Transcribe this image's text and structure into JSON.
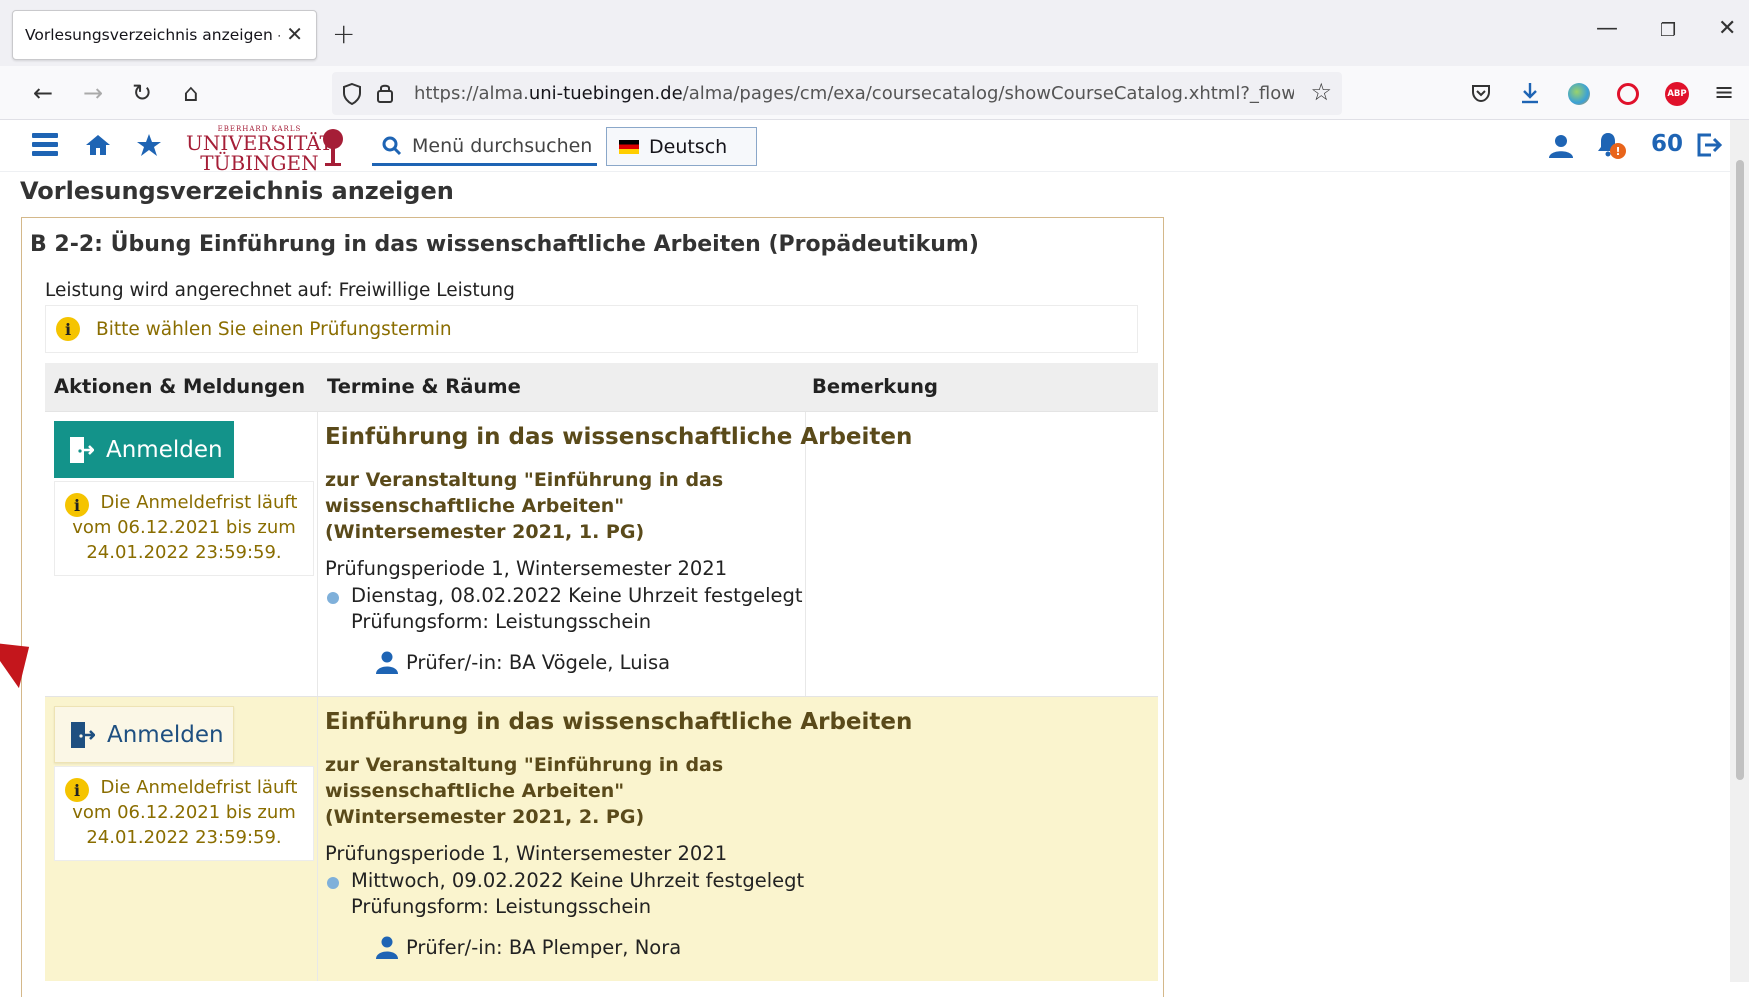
{
  "browser": {
    "tab_title": "Vorlesungsverzeichnis anzeigen - Eb",
    "new_tab_icon": "+",
    "url_prefix": "https://alma.",
    "url_domain": "uni-tuebingen.de",
    "url_path": "/alma/pages/cm/exa/coursecatalog/showCourseCatalog.xhtml?_flowId=show"
  },
  "app_toolbar": {
    "logo_small": "EBERHARD KARLS",
    "logo_line1": "UNIVERSITÄT",
    "logo_line2": "TÜBINGEN",
    "search_label": "Menü durchsuchen",
    "language": "Deutsch",
    "session_minutes": "60"
  },
  "page": {
    "title": "Vorlesungsverzeichnis anzeigen",
    "panel_title": "B 2-2: Übung Einführung in das wissenschaftliche Arbeiten (Propädeutikum)",
    "credit_line": "Leistung wird angerechnet auf: Freiwillige Leistung",
    "info_message": "Bitte wählen Sie einen Prüfungstermin"
  },
  "table": {
    "headers": [
      "Aktionen & Meldungen",
      "Termine & Räume",
      "Bemerkung"
    ],
    "rows": [
      {
        "button_label": "Anmelden",
        "deadline": "Die Anmeldefrist läuft vom 06.12.2021 bis zum 24.01.2022 23:59:59.",
        "event_title": "Einführung in das wissenschaftliche Arbeiten",
        "event_sub": "zur Veranstaltung \"Einführung in das wissenschaftliche Arbeiten\" (Wintersemester 2021, 1. PG)",
        "period": "Prüfungsperiode 1, Wintersemester 2021",
        "date": "Dienstag, 08.02.2022 Keine Uhrzeit festgelegt",
        "form": "Prüfungsform: Leistungsschein",
        "examiner": "Prüfer/-in: BA Vögele, Luisa"
      },
      {
        "button_label": "Anmelden",
        "deadline": "Die Anmeldefrist läuft vom 06.12.2021 bis zum 24.01.2022 23:59:59.",
        "event_title": "Einführung in das wissenschaftliche Arbeiten",
        "event_sub": "zur Veranstaltung \"Einführung in das wissenschaftliche Arbeiten\" (Wintersemester 2021, 2. PG)",
        "period": "Prüfungsperiode 1, Wintersemester 2021",
        "date": "Mittwoch, 09.02.2022 Keine Uhrzeit festgelegt",
        "form": "Prüfungsform: Leistungsschein",
        "examiner": "Prüfer/-in: BA Plemper, Nora"
      }
    ]
  },
  "colors": {
    "accent_blue": "#1e64b4",
    "primary_button": "#13938a",
    "highlight_row": "#faf4ce",
    "info_text": "#8a6d00",
    "brand_red": "#a51e37"
  }
}
